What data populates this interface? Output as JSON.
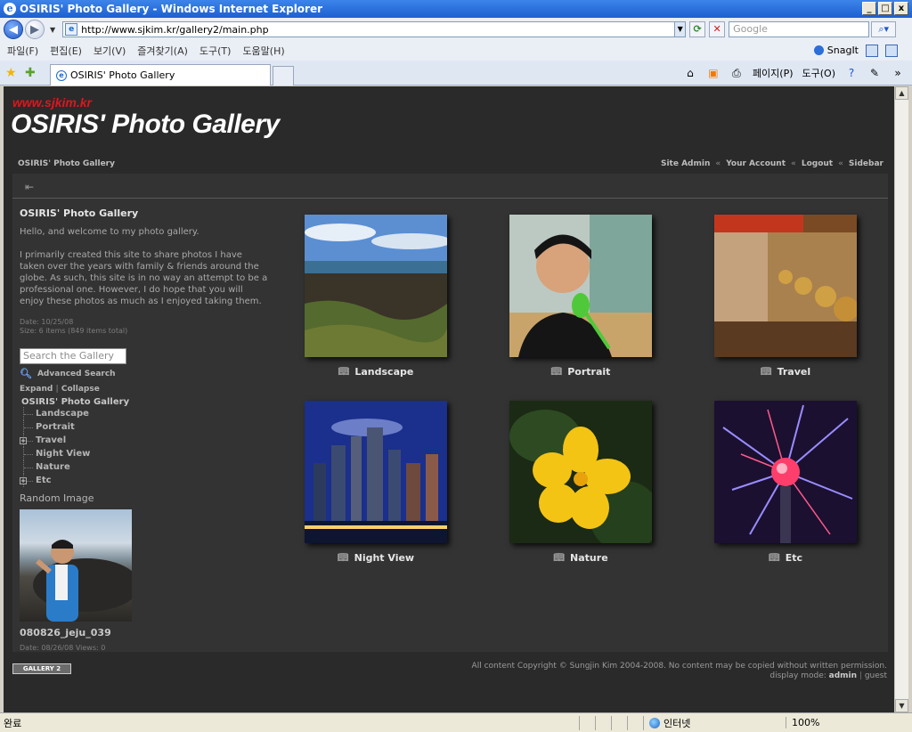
{
  "window": {
    "title": "OSIRIS' Photo Gallery - Windows Internet Explorer",
    "controls": [
      "_",
      "□",
      "x"
    ]
  },
  "address_bar": {
    "url": "http://www.sjkim.kr/gallery2/main.php",
    "search_placeholder": "Google"
  },
  "menu": {
    "items": [
      "파일(F)",
      "편집(E)",
      "보기(V)",
      "즐겨찾기(A)",
      "도구(T)",
      "도움말(H)"
    ],
    "snagit": "SnagIt"
  },
  "tab": {
    "label": "OSIRIS' Photo Gallery"
  },
  "toolbar": {
    "page": "페이지(P)",
    "tools": "도구(O)"
  },
  "site": {
    "url_text": "www.sjkim.kr",
    "title": "OSIRIS' Photo Gallery",
    "breadcrumb": "OSIRIS' Photo Gallery",
    "links": [
      "Site Admin",
      "Your Account",
      "Logout",
      "Sidebar"
    ],
    "link_sep": "«"
  },
  "sidebar": {
    "heading": "OSIRIS' Photo Gallery",
    "intro": "Hello, and welcome to my photo gallery.",
    "body": "I primarily created this site to share photos I have taken over the years with family & friends around the globe. As such, this site is in no way an attempt to be a professional one. However, I do hope that you will enjoy these photos as much as I enjoyed taking them.",
    "date": "Date: 10/25/08",
    "size": "Size: 6 items (849 items total)",
    "search_placeholder": "Search the Gallery",
    "advanced_search": "Advanced Search",
    "expand": "Expand",
    "collapse": "Collapse",
    "tree_root": "OSIRIS' Photo Gallery",
    "tree": [
      {
        "label": "Landscape",
        "expandable": false
      },
      {
        "label": "Portrait",
        "expandable": false
      },
      {
        "label": "Travel",
        "expandable": true
      },
      {
        "label": "Night View",
        "expandable": false
      },
      {
        "label": "Nature",
        "expandable": false
      },
      {
        "label": "Etc",
        "expandable": true
      }
    ],
    "random_heading": "Random Image",
    "random_name": "080826_jeju_039",
    "random_meta": "Date: 08/26/08 Views: 0"
  },
  "albums": [
    {
      "label": "Landscape"
    },
    {
      "label": "Portrait"
    },
    {
      "label": "Travel"
    },
    {
      "label": "Night View"
    },
    {
      "label": "Nature"
    },
    {
      "label": "Etc"
    }
  ],
  "footer": {
    "logo": "GALLERY 2",
    "copyright": "All content Copyright © Sungjin Kim 2004-2008. No content may be copied without written permission.",
    "display_mode_label": "display mode:",
    "mode_admin": "admin",
    "mode_guest": "guest"
  },
  "status": {
    "text": "완료",
    "zone": "인터넷",
    "zoom": "100%"
  }
}
